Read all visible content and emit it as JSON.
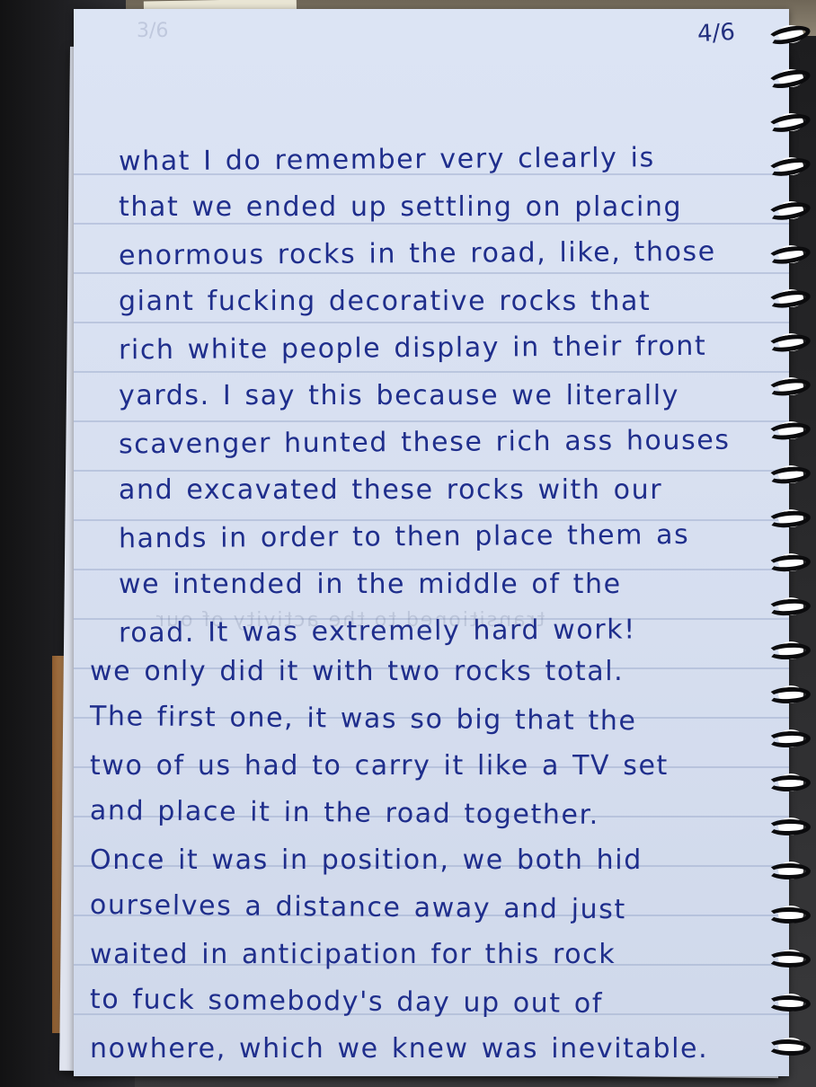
{
  "notebook": {
    "page_number": "4/6",
    "ghost_page_number": "3/6",
    "bleed_through_text": "transitioned to the activity of our",
    "paragraphs": [
      {
        "lines": [
          "what I do remember very clearly is",
          "that we ended up settling on placing",
          "enormous rocks in the road, like, those",
          "giant fucking decorative rocks that",
          "rich white people display in their front",
          "yards. I say this because we literally",
          "scavenger hunted these rich ass houses",
          "and excavated these rocks with our",
          "hands in order to then place them as",
          "we intended in the middle of the",
          "road. It was extremely hard work!"
        ]
      },
      {
        "lines": [
          "we only did it with two rocks total.",
          "The first one, it was so big that the",
          "two of us had to carry it like a TV set",
          "and place it in the road together.",
          "Once it was in position, we both hid",
          "ourselves a distance away and just",
          "waited in anticipation for this rock",
          "to fuck somebody's day up out of",
          "nowhere, which we knew was inevitable."
        ]
      }
    ],
    "colors": {
      "ink": "#1f2e8c",
      "paper": "#dce4f4",
      "rule": "#96a5c8",
      "coil": "#0b0b0d"
    }
  }
}
